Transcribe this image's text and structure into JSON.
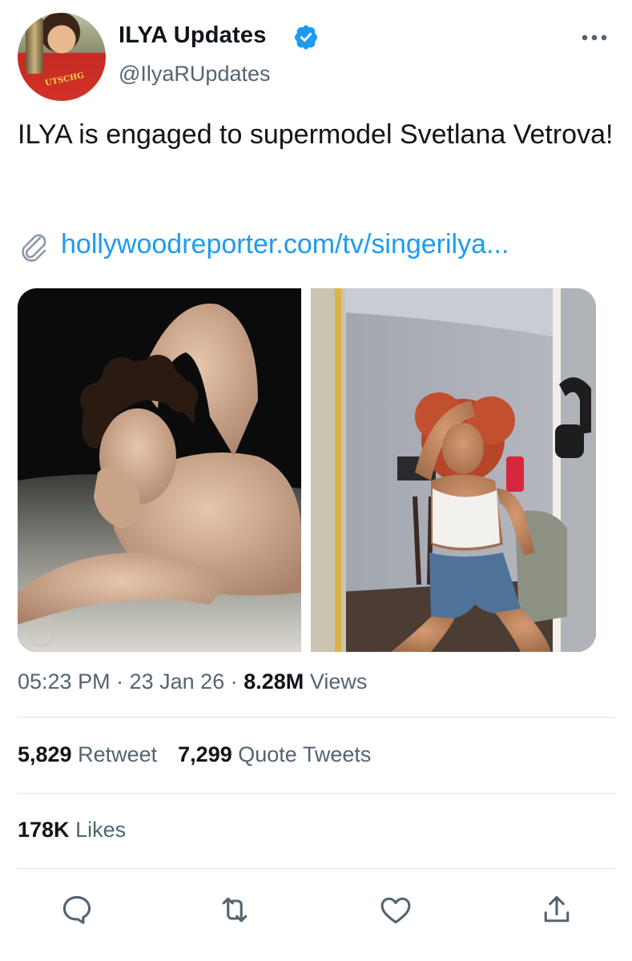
{
  "header": {
    "display_name": "ILYA Updates",
    "handle": "@IlyaRUpdates",
    "avatar_shirt_text": "UTSCHG"
  },
  "tweet": {
    "text": "ILYA is engaged to supermodel Svetlana Vetrova!",
    "link": "hollywoodreporter.com/tv/singerilya..."
  },
  "meta": {
    "time": "05:23 PM",
    "sep1": "·",
    "date": "23 Jan 26",
    "sep2": "·",
    "views_count": "8.28M",
    "views_label": "Views"
  },
  "stats": {
    "retweets_count": "5,829",
    "retweets_label": "Retweet",
    "quotes_count": "7,299",
    "quotes_label": "Quote Tweets",
    "likes_count": "178K",
    "likes_label": "Likes"
  },
  "icons": {
    "verified": "verified-badge-icon",
    "more": "more-options-icon",
    "paperclip": "paperclip-icon",
    "reply": "reply-icon",
    "retweet": "retweet-icon",
    "like": "heart-icon",
    "share": "share-icon"
  },
  "colors": {
    "accent": "#1d9bf0",
    "text": "#0f1419",
    "secondary": "#536471",
    "divider": "#dfe3e6"
  }
}
